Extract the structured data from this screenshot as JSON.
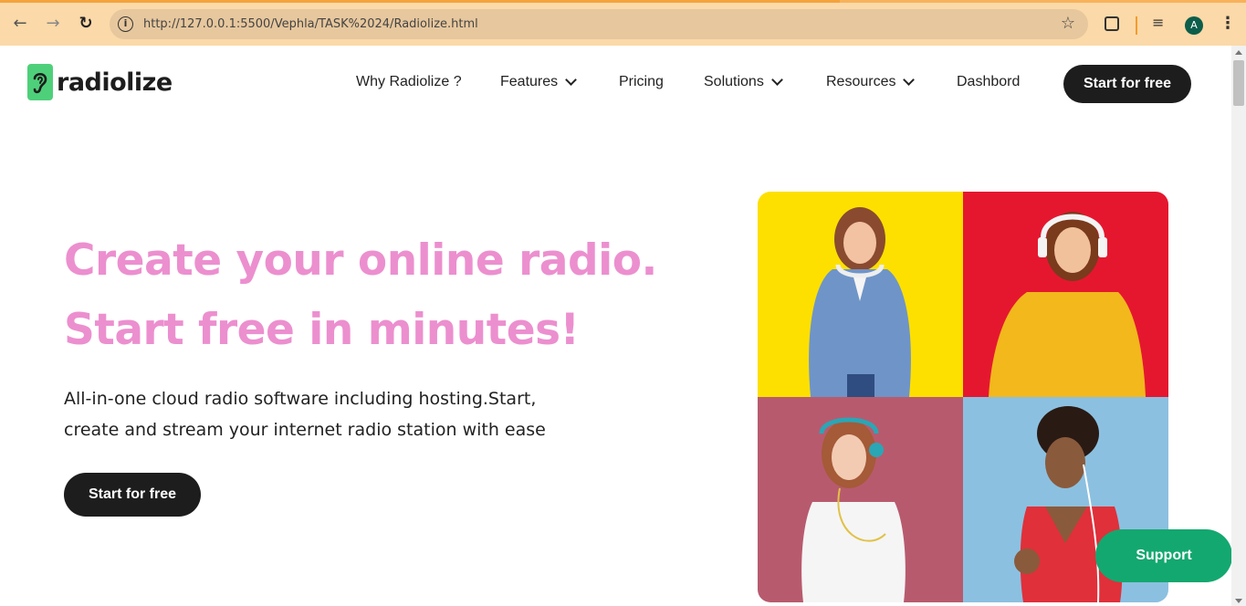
{
  "browser": {
    "url": "http://127.0.0.1:5500/Vephla/TASK%2024/Radiolize.html",
    "profile_initial": "A"
  },
  "brand": {
    "name": "radiolize",
    "accent": "#4ed07a"
  },
  "nav": {
    "items": [
      {
        "label": "Why Radiolize ?",
        "has_dropdown": false
      },
      {
        "label": "Features",
        "has_dropdown": true
      },
      {
        "label": "Pricing",
        "has_dropdown": false
      },
      {
        "label": "Solutions",
        "has_dropdown": true
      },
      {
        "label": "Resources",
        "has_dropdown": true
      },
      {
        "label": "Dashbord",
        "has_dropdown": false
      }
    ],
    "cta": "Start for free"
  },
  "hero": {
    "title_line1": "Create your online radio.",
    "title_line2": "Start free in minutes!",
    "subtitle_line1": "All-in-one cloud radio software including hosting.Start,",
    "subtitle_line2": "create and stream your internet radio station with ease",
    "cta": "Start for free",
    "title_color": "#ec8fcf"
  },
  "gallery": {
    "tiles": [
      {
        "name": "woman-denim-jacket-headphones",
        "background": "#fde000"
      },
      {
        "name": "woman-yellow-sweater-headphones",
        "background": "#e5172f"
      },
      {
        "name": "woman-white-tshirt-earphones",
        "background": "#b85a6e"
      },
      {
        "name": "man-red-tank-earphones",
        "background": "#8cc0e0"
      }
    ]
  },
  "support": {
    "label": "Support",
    "color": "#13a86f"
  }
}
